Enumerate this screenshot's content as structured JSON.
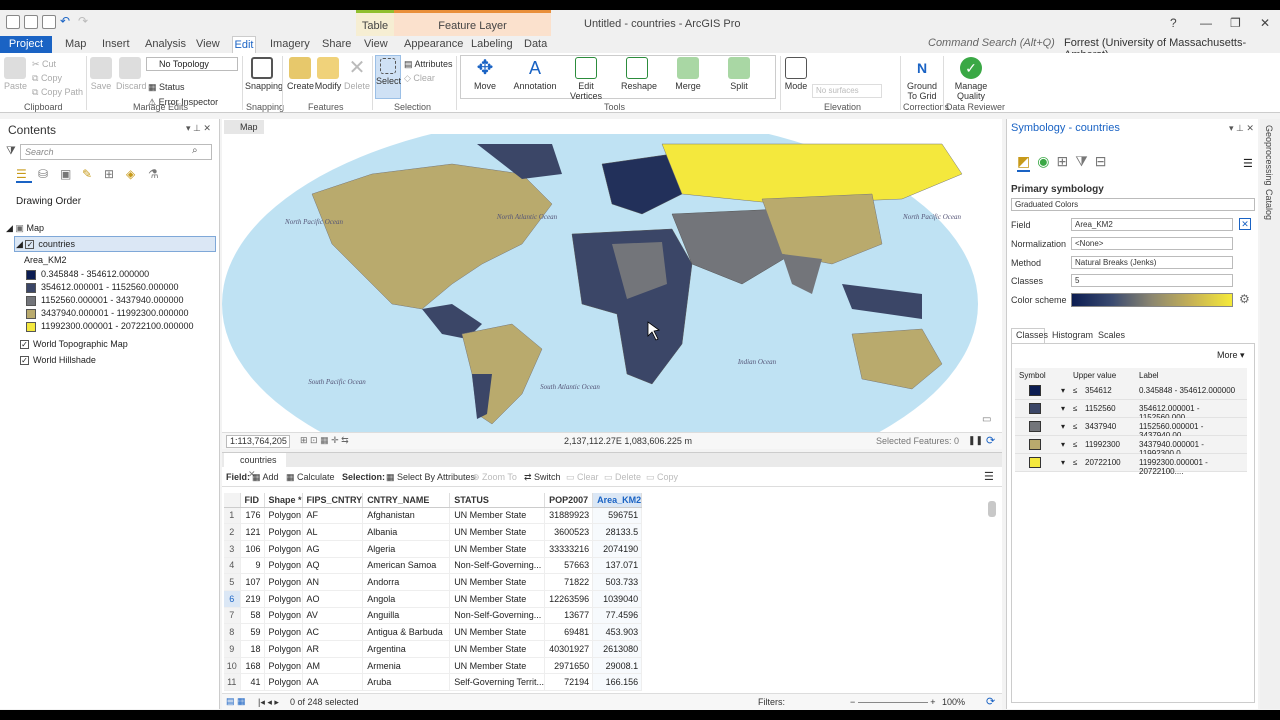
{
  "title_bar": {
    "app_title": "Untitled - countries - ArcGIS Pro",
    "context_table": "Table",
    "context_feature": "Feature Layer",
    "help": "?"
  },
  "tabs": {
    "project": "Project",
    "items": [
      "Map",
      "Insert",
      "Analysis",
      "View",
      "Edit",
      "Imagery",
      "Share",
      "View",
      "Appearance",
      "Labeling",
      "Data"
    ],
    "command_search": "Command Search (Alt+Q)",
    "user": "Forrest (University of Massachusetts-Amherst)"
  },
  "ribbon": {
    "clipboard": {
      "paste": "Paste",
      "cut": "Cut",
      "copy": "Copy",
      "copy_path": "Copy Path",
      "label": "Clipboard"
    },
    "manage_edits": {
      "save": "Save",
      "discard": "Discard",
      "topology": "No Topology",
      "status": "Status",
      "error_inspector": "Error Inspector",
      "label": "Manage Edits"
    },
    "snapping": {
      "button": "Snapping",
      "label": "Snapping"
    },
    "features": {
      "create": "Create",
      "modify": "Modify",
      "delete": "Delete",
      "label": "Features"
    },
    "selection": {
      "select": "Select",
      "attributes": "Attributes",
      "clear": "Clear",
      "label": "Selection"
    },
    "tools": {
      "move": "Move",
      "annotation": "Annotation",
      "edit_vertices": "Edit Vertices",
      "reshape": "Reshape",
      "merge": "Merge",
      "split": "Split",
      "label": "Tools"
    },
    "elevation": {
      "mode": "Mode",
      "no_surfaces": "No surfaces",
      "label": "Elevation"
    },
    "corrections": {
      "ground": "Ground To Grid",
      "label": "Corrections"
    },
    "data_reviewer": {
      "manage": "Manage Quality",
      "label": "Data Reviewer"
    }
  },
  "contents": {
    "title": "Contents",
    "search_placeholder": "Search",
    "drawing_order": "Drawing Order",
    "map": "Map",
    "layer": "countries",
    "field": "Area_KM2",
    "classes": [
      {
        "label": "0.345848 - 354612.000000",
        "color": "#0c1d52"
      },
      {
        "label": "354612.000001 - 1152560.000000",
        "color": "#3b4667"
      },
      {
        "label": "1152560.000001 - 3437940.000000",
        "color": "#73757a"
      },
      {
        "label": "3437940.000001 - 11992300.000000",
        "color": "#b9aa6d"
      },
      {
        "label": "11992300.000001 - 20722100.000000",
        "color": "#f4e83d"
      }
    ],
    "basemaps": [
      "World Topographic Map",
      "World Hillshade"
    ]
  },
  "map": {
    "tab": "Map",
    "scale": "1:113,764,205",
    "coordinates": "2,137,112.27E 1,083,606.225 m",
    "selected_features": "Selected Features: 0",
    "ocean_labels": [
      {
        "text": "North Pacific Ocean"
      },
      {
        "text": "North Atlantic Ocean"
      },
      {
        "text": "North Pacific Ocean"
      },
      {
        "text": "South Pacific Ocean"
      },
      {
        "text": "South Atlantic Ocean"
      },
      {
        "text": "Indian Ocean"
      }
    ]
  },
  "attribute_table": {
    "tab": "countries",
    "field_label": "Field:",
    "add": "Add",
    "calculate": "Calculate",
    "selection_label": "Selection:",
    "select_by_attributes": "Select By Attributes",
    "zoom_to": "Zoom To",
    "switch": "Switch",
    "clear": "Clear",
    "delete": "Delete",
    "copy": "Copy",
    "columns": [
      "FID",
      "Shape *",
      "FIPS_CNTRY",
      "CNTRY_NAME",
      "STATUS",
      "POP2007",
      "Area_KM2"
    ],
    "rows": [
      [
        "1",
        "176",
        "Polygon",
        "AF",
        "Afghanistan",
        "UN Member State",
        "31889923",
        "596751"
      ],
      [
        "2",
        "121",
        "Polygon",
        "AL",
        "Albania",
        "UN Member State",
        "3600523",
        "28133.5"
      ],
      [
        "3",
        "106",
        "Polygon",
        "AG",
        "Algeria",
        "UN Member State",
        "33333216",
        "2074190"
      ],
      [
        "4",
        "9",
        "Polygon",
        "AQ",
        "American Samoa",
        "Non-Self-Governing...",
        "57663",
        "137.071"
      ],
      [
        "5",
        "107",
        "Polygon",
        "AN",
        "Andorra",
        "UN Member State",
        "71822",
        "503.733"
      ],
      [
        "6",
        "219",
        "Polygon",
        "AO",
        "Angola",
        "UN Member State",
        "12263596",
        "1039040"
      ],
      [
        "7",
        "58",
        "Polygon",
        "AV",
        "Anguilla",
        "Non-Self-Governing...",
        "13677",
        "77.4596"
      ],
      [
        "8",
        "59",
        "Polygon",
        "AC",
        "Antigua & Barbuda",
        "UN Member State",
        "69481",
        "453.903"
      ],
      [
        "9",
        "18",
        "Polygon",
        "AR",
        "Argentina",
        "UN Member State",
        "40301927",
        "2613080"
      ],
      [
        "10",
        "168",
        "Polygon",
        "AM",
        "Armenia",
        "UN Member State",
        "2971650",
        "29008.1"
      ],
      [
        "11",
        "41",
        "Polygon",
        "AA",
        "Aruba",
        "Self-Governing Territ...",
        "72194",
        "166.156"
      ]
    ],
    "selected_count": "0 of 248 selected",
    "filters": "Filters:",
    "zoom": "100%"
  },
  "symbology": {
    "title": "Symbology - countries",
    "primary": "Primary symbology",
    "method_type": "Graduated Colors",
    "field_label": "Field",
    "field_value": "Area_KM2",
    "normalization_label": "Normalization",
    "normalization_value": "<None>",
    "method_label": "Method",
    "method_value": "Natural Breaks (Jenks)",
    "classes_label": "Classes",
    "classes_value": "5",
    "color_scheme_label": "Color scheme",
    "tabs": [
      "Classes",
      "Histogram",
      "Scales"
    ],
    "more": "More",
    "col_symbol": "Symbol",
    "col_upper": "Upper value",
    "col_label": "Label",
    "rows": [
      {
        "upper": "354612",
        "label": "0.345848 - 354612.000000",
        "color": "#0c1d52"
      },
      {
        "upper": "1152560",
        "label": "354612.000001 - 1152560.000...",
        "color": "#3b4667"
      },
      {
        "upper": "3437940",
        "label": "1152560.000001 - 3437940.00...",
        "color": "#73757a"
      },
      {
        "upper": "11992300",
        "label": "3437940.000001 - 11992300.0...",
        "color": "#b9aa6d"
      },
      {
        "upper": "20722100",
        "label": "11992300.000001 - 20722100....",
        "color": "#f4e83d"
      }
    ],
    "leq": "≤"
  },
  "right_sidebar": {
    "geoprocessing": "Geoprocessing",
    "catalog": "Catalog"
  }
}
